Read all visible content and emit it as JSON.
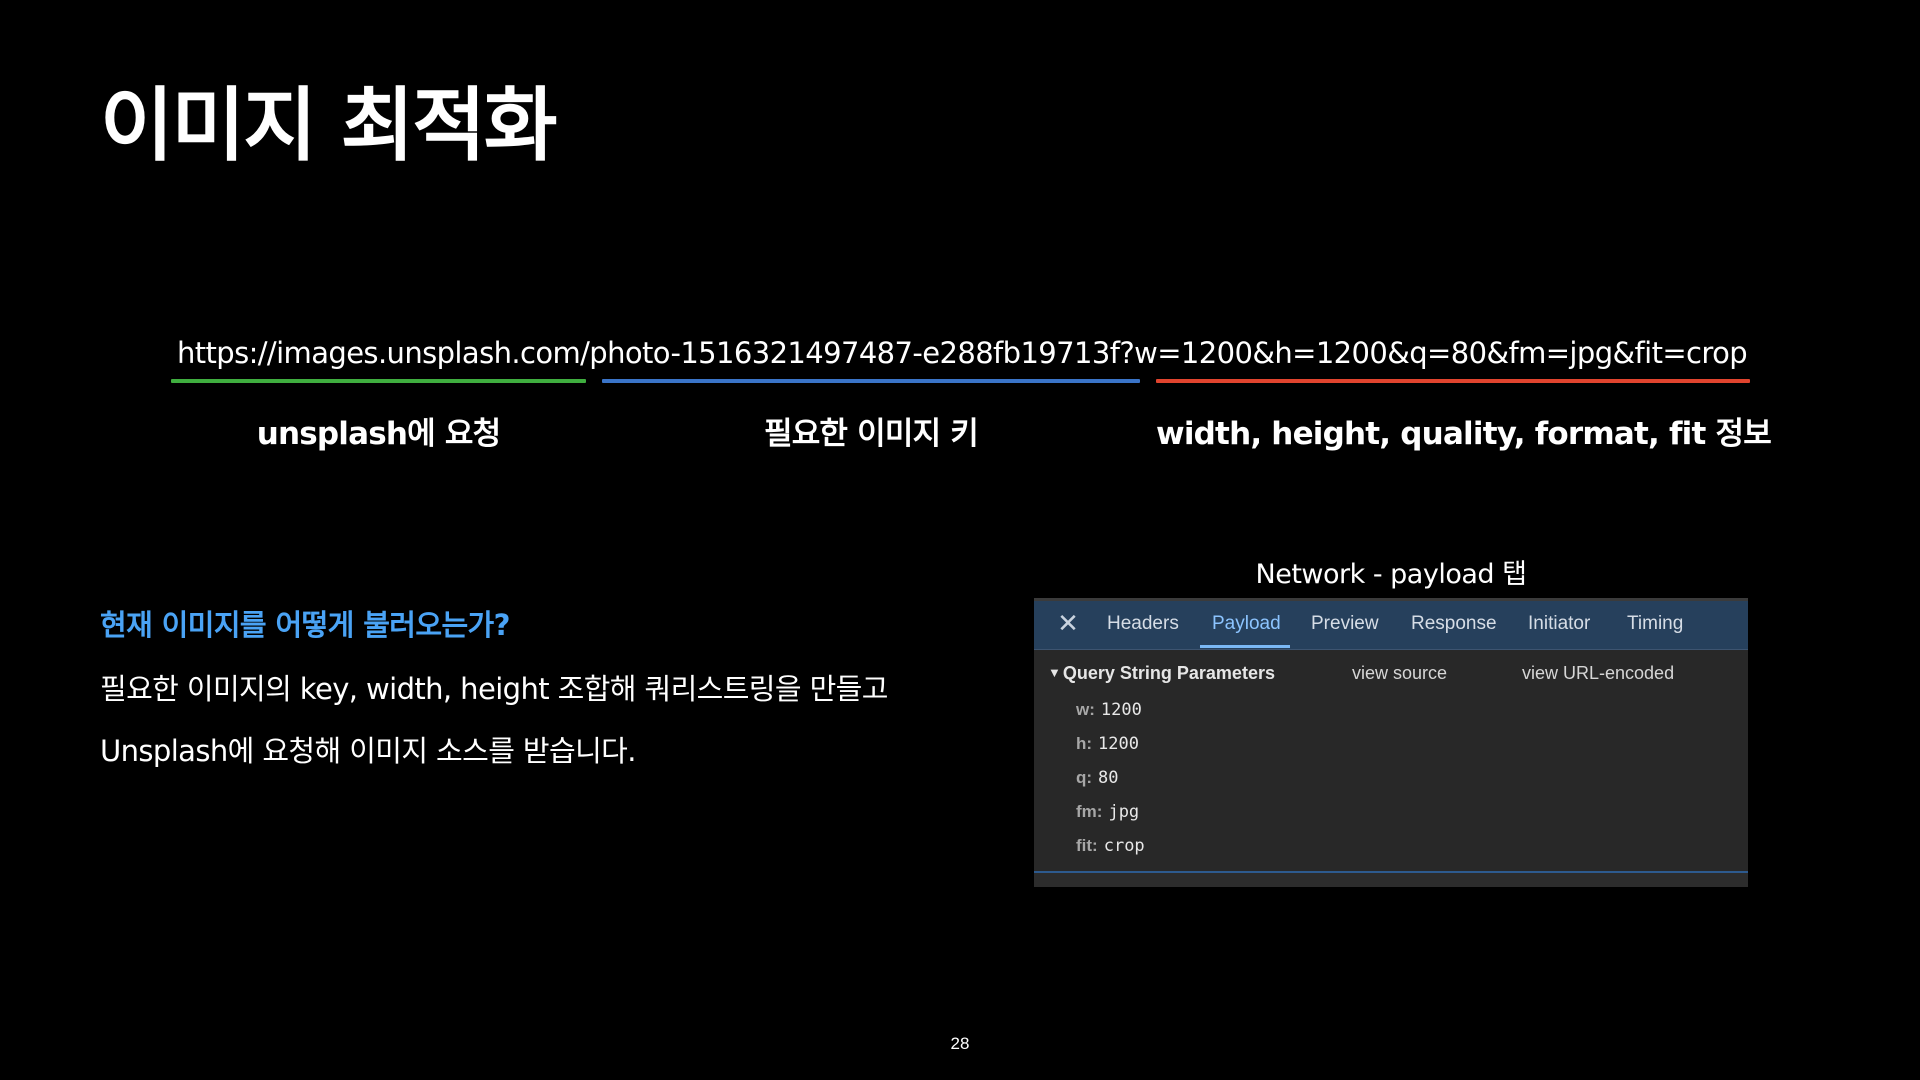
{
  "slide": {
    "title": "이미지 최적화",
    "page_number": "28"
  },
  "url": {
    "full": "https://images.unsplash.com/photo-1516321497487-e288fb19713f?w=1200&h=1200&q=80&fm=jpg&fit=crop",
    "segments": [
      {
        "label": "unsplash에 요청",
        "color": "#3fae3f"
      },
      {
        "label": "필요한 이미지 키",
        "color": "#3a74c8"
      },
      {
        "label": "width, height, quality, format, fit 정보",
        "color": "#e0442e"
      }
    ]
  },
  "explanation": {
    "question": "현재 이미지를 어떻게 불러오는가?",
    "line1": "필요한 이미지의 key, width, height 조합해 쿼리스트링을 만들고",
    "line2": "Unsplash에 요청해 이미지 소스를 받습니다."
  },
  "devtools": {
    "caption": "Network - payload 탭",
    "close_icon": "close-icon",
    "tabs": [
      {
        "label": "Headers",
        "active": false
      },
      {
        "label": "Payload",
        "active": true
      },
      {
        "label": "Preview",
        "active": false
      },
      {
        "label": "Response",
        "active": false
      },
      {
        "label": "Initiator",
        "active": false
      },
      {
        "label": "Timing",
        "active": false
      }
    ],
    "section_title": "Query String Parameters",
    "view_source": "view source",
    "view_url_encoded": "view URL-encoded",
    "params": [
      {
        "key": "w:",
        "value": "1200"
      },
      {
        "key": "h:",
        "value": "1200"
      },
      {
        "key": "q:",
        "value": "80"
      },
      {
        "key": "fm:",
        "value": "jpg"
      },
      {
        "key": "fit:",
        "value": "crop"
      }
    ],
    "colors": {
      "tabbar": "#26405c",
      "active_tab": "#8cc4ff",
      "panel": "#282828"
    }
  }
}
